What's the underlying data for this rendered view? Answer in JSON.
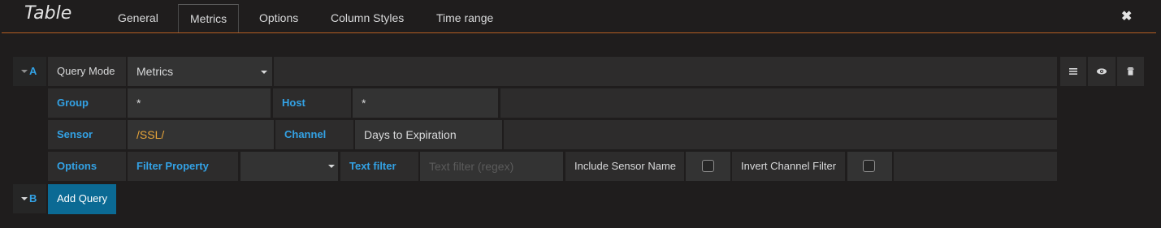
{
  "panel": {
    "title": "Table",
    "close_glyph": "✖"
  },
  "tabs": [
    {
      "label": "General",
      "active": false
    },
    {
      "label": "Metrics",
      "active": true
    },
    {
      "label": "Options",
      "active": false
    },
    {
      "label": "Column Styles",
      "active": false
    },
    {
      "label": "Time range",
      "active": false
    }
  ],
  "query_a": {
    "ref_id": "A",
    "query_mode_label": "Query Mode",
    "query_mode_value": "Metrics",
    "group_label": "Group",
    "group_value": "*",
    "host_label": "Host",
    "host_value": "*",
    "sensor_label": "Sensor",
    "sensor_value": "/SSL/",
    "channel_label": "Channel",
    "channel_value": "Days to Expiration",
    "options_label": "Options",
    "filter_property_label": "Filter Property",
    "filter_property_value": "",
    "text_filter_label": "Text filter",
    "text_filter_placeholder": "Text filter (regex)",
    "include_sensor_name_label": "Include Sensor Name",
    "include_sensor_name_checked": false,
    "invert_channel_filter_label": "Invert Channel Filter",
    "invert_channel_filter_checked": false
  },
  "query_b": {
    "ref_id": "B",
    "add_query_label": "Add Query"
  },
  "icons": [
    "hamburger-menu-icon",
    "eye-icon",
    "trash-icon",
    "caret-down-icon",
    "close-icon"
  ],
  "colors": {
    "accent_orange": "#b45e23",
    "label_blue": "#33a2e5",
    "value_orange": "#e8a53a",
    "button_blue": "#0b6a94"
  }
}
